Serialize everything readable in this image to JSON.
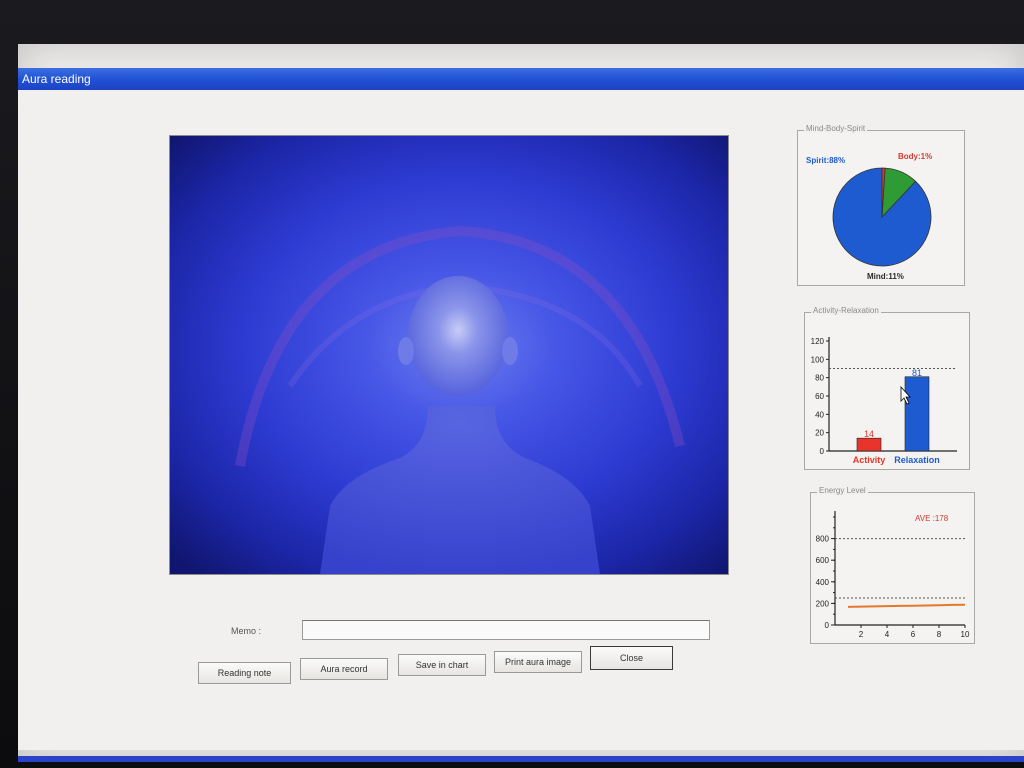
{
  "window": {
    "title": "Aura reading"
  },
  "memo": {
    "label": "Memo :",
    "value": ""
  },
  "buttons": {
    "reading_note": "Reading note",
    "aura_record": "Aura record",
    "save_in_chart": "Save in chart",
    "print_aura_image": "Print aura image",
    "close": "Close"
  },
  "panels": {
    "mind_body_spirit": "Mind-Body-Spirit",
    "activity_relaxation": "Activity-Relaxation",
    "energy_level": "Energy Level"
  },
  "colors": {
    "titlebar": "#2352d6",
    "aura_blue": "#2433c8",
    "spirit": "#1f5bd0",
    "mind": "#2e9b35",
    "body": "#d23a2f",
    "activity_bar": "#e8342a",
    "relaxation_bar": "#1f5bd0",
    "energy_line": "#e6782c"
  },
  "chart_data": [
    {
      "type": "pie",
      "title": "Mind-Body-Spirit",
      "slices": [
        {
          "label": "Spirit:88%",
          "name": "Spirit",
          "value": 88,
          "color": "#1f5bd0"
        },
        {
          "label": "Mind:11%",
          "name": "Mind",
          "value": 11,
          "color": "#2e9b35"
        },
        {
          "label": "Body:1%",
          "name": "Body",
          "value": 1,
          "color": "#d23a2f"
        }
      ]
    },
    {
      "type": "bar",
      "title": "Activity-Relaxation",
      "categories": [
        "Activity",
        "Relaxation"
      ],
      "values": [
        14,
        81
      ],
      "value_labels": [
        "14",
        "81"
      ],
      "colors": [
        "#e8342a",
        "#1f5bd0"
      ],
      "ylim": [
        0,
        120
      ],
      "yticks": [
        0,
        20,
        40,
        60,
        80,
        100,
        120
      ],
      "reference_line": 90
    },
    {
      "type": "line",
      "title": "Energy Level",
      "annotation": "AVE :178",
      "x": [
        1,
        2,
        3,
        4,
        5,
        6,
        7,
        8,
        9,
        10
      ],
      "values": [
        168,
        170,
        172,
        175,
        177,
        178,
        180,
        183,
        186,
        188
      ],
      "xlim": [
        0,
        10
      ],
      "ylim": [
        0,
        1000
      ],
      "xticks": [
        2,
        4,
        6,
        8,
        10
      ],
      "yticks": [
        0,
        200,
        400,
        600,
        800
      ],
      "reference_lines": [
        250,
        800
      ],
      "color": "#e6782c"
    }
  ]
}
